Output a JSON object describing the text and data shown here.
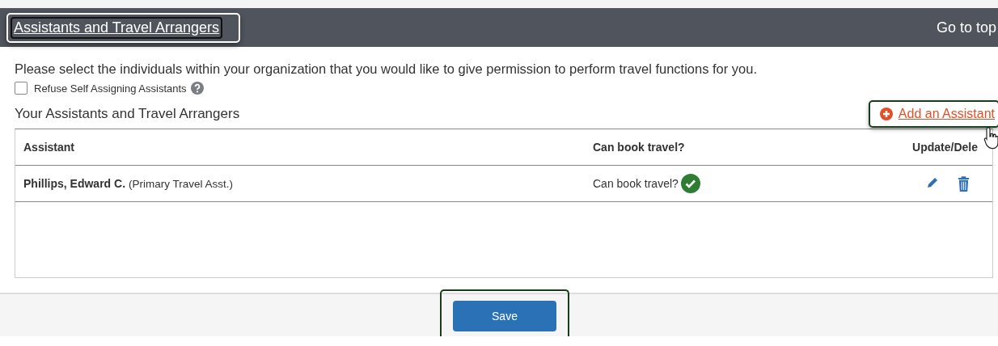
{
  "header": {
    "title": "Assistants and Travel Arrangers",
    "go_to_top": "Go to top"
  },
  "intro": "Please select the individuals within your organization that you would like to give permission to perform travel functions for you.",
  "refuse_self_assigning": {
    "label": "Refuse Self Assigning Assistants",
    "checked": false
  },
  "section_title": "Your Assistants and Travel Arrangers",
  "add_assistant": "Add an Assistant",
  "table": {
    "columns": [
      "Assistant",
      "Can book travel?",
      "Update/Dele"
    ],
    "rows": [
      {
        "name": "Phillips, Edward C.",
        "role": "(Primary Travel Asst.)",
        "can_book_label": "Can book travel?",
        "can_book": true
      }
    ]
  },
  "save": "Save"
}
